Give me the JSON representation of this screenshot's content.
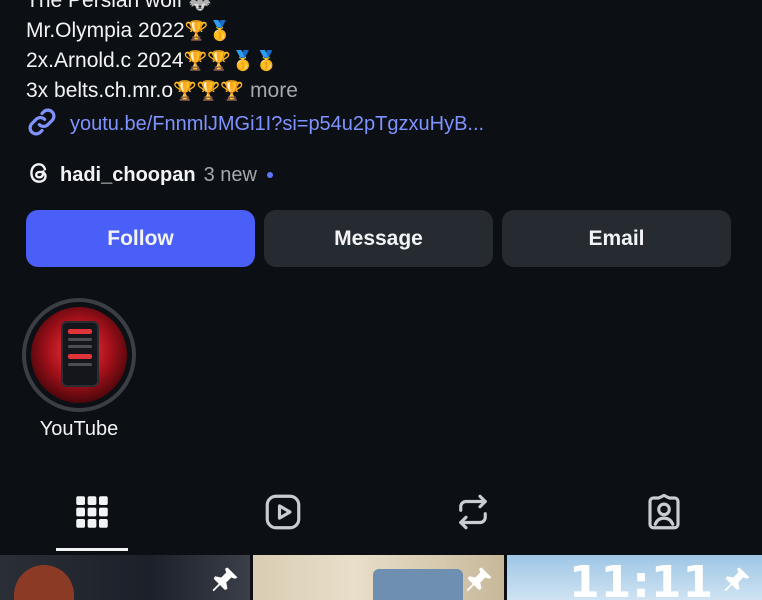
{
  "bio": {
    "line1": "The Persian wolf",
    "line2_text": "Mr.Olympia 2022",
    "line3_text": "2x.Arnold.c 2024",
    "line4_text": "3x belts.ch.mr.o",
    "more_label": "more"
  },
  "link": {
    "icon": "link-icon",
    "text": "youtu.be/FnnmlJMGi1I?si=p54u2pTgzxuHyB..."
  },
  "threads": {
    "icon": "threads-icon",
    "handle": "hadi_choopan",
    "new_label": "3 new"
  },
  "actions": {
    "follow_label": "Follow",
    "message_label": "Message",
    "email_label": "Email"
  },
  "highlight": {
    "label": "YouTube"
  },
  "tabs": [
    {
      "icon": "grid-icon",
      "selected": true
    },
    {
      "icon": "reels-icon",
      "selected": false
    },
    {
      "icon": "repost-icon",
      "selected": false
    },
    {
      "icon": "tagged-icon",
      "selected": false
    }
  ],
  "posts": [
    {
      "pinned": true,
      "overlay_text": ""
    },
    {
      "pinned": true,
      "overlay_text": ""
    },
    {
      "pinned": true,
      "overlay_text": "11:11"
    }
  ],
  "colors": {
    "background": "#0c0f14",
    "follow_button": "#4a5ef8",
    "secondary_button": "#262a31",
    "link": "#7f93ff",
    "muted_text": "#a4a8b0"
  }
}
